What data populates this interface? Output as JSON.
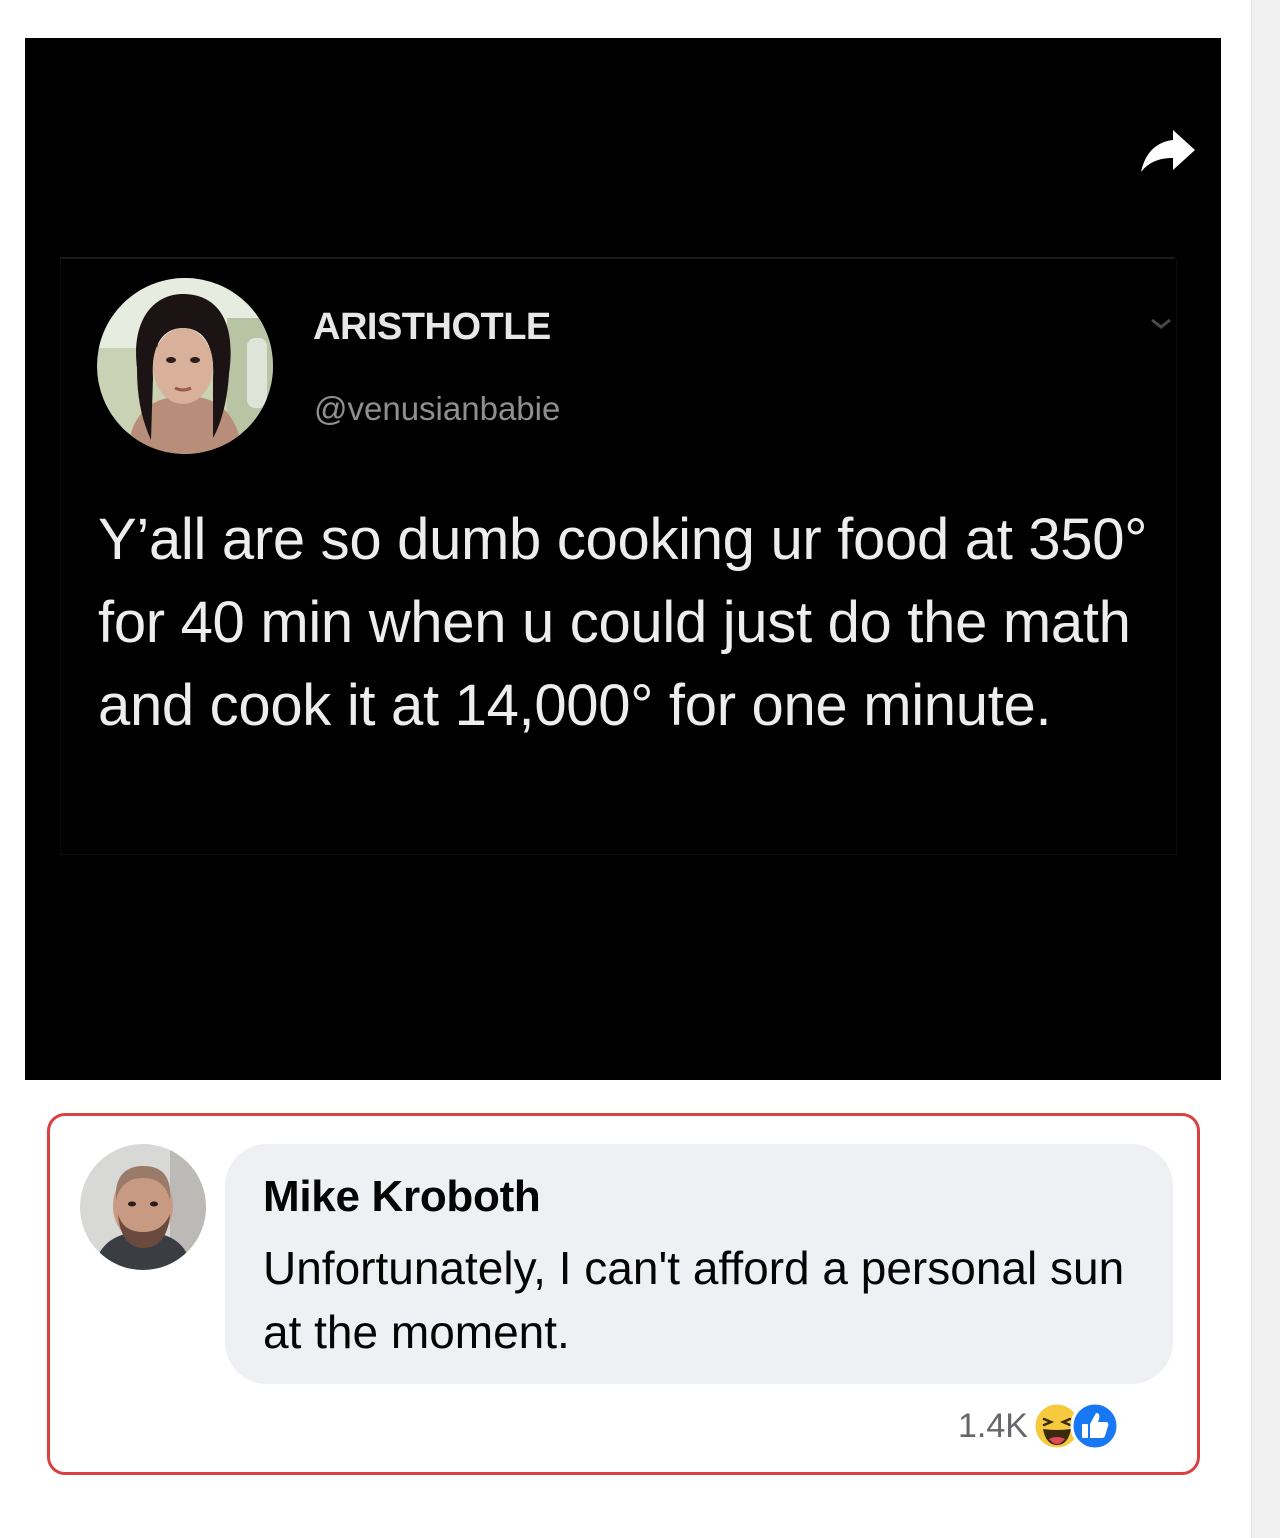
{
  "tweet": {
    "author_name": "ARISTHOTLE",
    "author_handle": "@venusianbabie",
    "text": "Y’all are so dumb cooking ur food at 350° for 40 min when u could just do the math and cook it at 14,000° for one minute."
  },
  "comment": {
    "author_name": "Mike Kroboth",
    "text": "Unfortunately, I can't afford a personal sun at the moment.",
    "reaction_count": "1.4K",
    "reactions": [
      "haha-icon",
      "like-icon"
    ]
  },
  "colors": {
    "tweet_background": "#000000",
    "highlight_border": "#d94141",
    "comment_bubble": "#eff0f3",
    "like_blue": "#1877f2",
    "haha_yellow": "#f7c93e"
  }
}
